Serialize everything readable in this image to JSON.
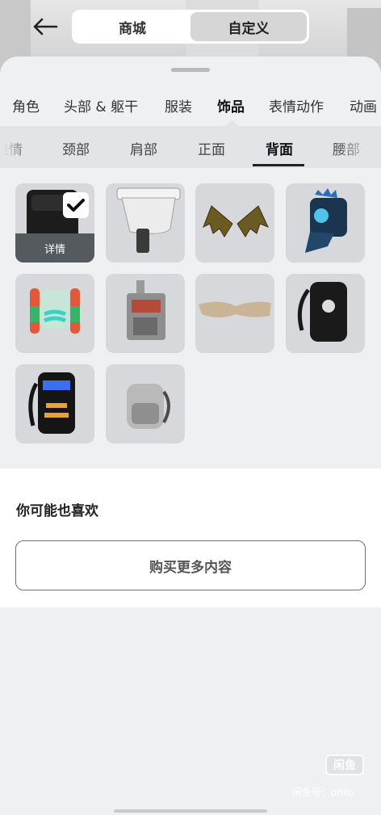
{
  "header": {
    "back_icon": "arrow-left-icon",
    "segments": [
      {
        "label": "商城",
        "active": false
      },
      {
        "label": "自定义",
        "active": true
      }
    ]
  },
  "categories": [
    {
      "label": "角色",
      "active": false
    },
    {
      "label": "头部 & 躯干",
      "active": false
    },
    {
      "label": "服装",
      "active": false
    },
    {
      "label": "饰品",
      "active": true
    },
    {
      "label": "表情动作",
      "active": false
    },
    {
      "label": "动画",
      "active": false
    }
  ],
  "subcategories": [
    {
      "label": "表情",
      "active": false
    },
    {
      "label": "颈部",
      "active": false
    },
    {
      "label": "肩部",
      "active": false
    },
    {
      "label": "正面",
      "active": false
    },
    {
      "label": "背面",
      "active": true
    },
    {
      "label": "腰部",
      "active": false
    }
  ],
  "items": [
    {
      "name": "black-backpack-equipped",
      "equipped": true,
      "detail_label": "详情"
    },
    {
      "name": "white-sink-backpack"
    },
    {
      "name": "bat-wings"
    },
    {
      "name": "blue-monster-backpack"
    },
    {
      "name": "rainbow-jetpack"
    },
    {
      "name": "robot-backpack"
    },
    {
      "name": "tan-wings"
    },
    {
      "name": "jurassic-backpack"
    },
    {
      "name": "fx-artist-backpack"
    },
    {
      "name": "gray-backpack"
    }
  ],
  "recommend": {
    "title": "你可能也喜欢",
    "buy_more_label": "购买更多内容"
  },
  "watermark": {
    "logo": "闲鱼",
    "text": "闲鱼号：ohllo"
  },
  "colors": {
    "sheet_bg": "#eef0f2",
    "tile_bg": "#d6d8db",
    "sub_bar_bg": "#e2e4e7"
  }
}
